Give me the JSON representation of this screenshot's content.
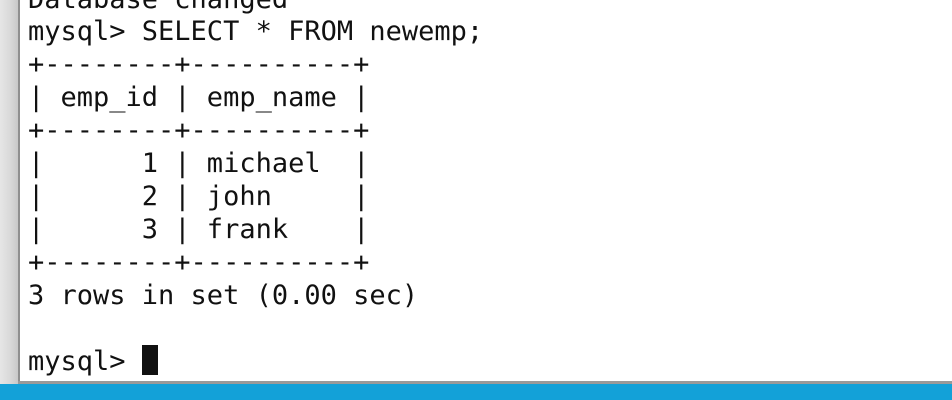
{
  "terminal": {
    "lines": [
      "Database changed",
      "mysql> SELECT * FROM newemp;",
      "+--------+----------+",
      "| emp_id | emp_name |",
      "+--------+----------+",
      "|      1 | michael  |",
      "|      2 | john     |",
      "|      3 | frank    |",
      "+--------+----------+",
      "3 rows in set (0.00 sec)",
      "",
      "mysql>"
    ]
  },
  "colors": {
    "terminal_background": "#ffffff",
    "terminal_text": "#111111",
    "taskbar": "#13a1d8"
  }
}
